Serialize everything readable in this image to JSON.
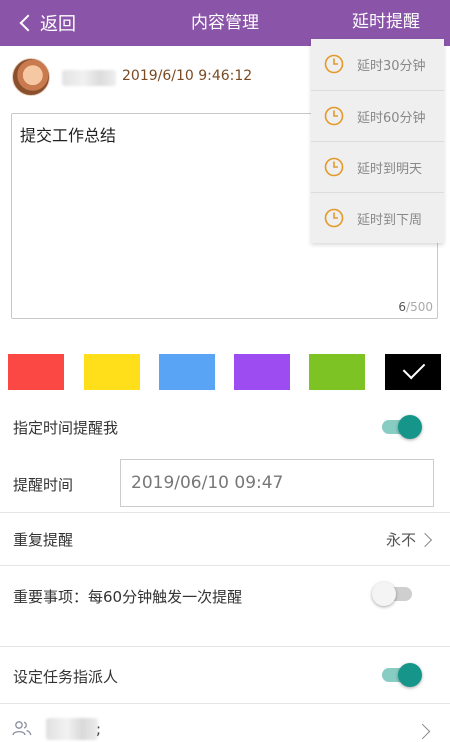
{
  "header": {
    "back_label": "返回",
    "title": "内容管理",
    "delay_label": "延时提醒"
  },
  "note": {
    "datetime": "2019/6/10 9:46:12",
    "content": "提交工作总结",
    "count_current": "6",
    "count_max": "/500"
  },
  "colors": {
    "header_bg": "#8a55a8",
    "toggle_on": "#16968a",
    "clock_orange": "#e39a2a",
    "swatches": [
      "#fb4844",
      "#ffdf19",
      "#5aa4f6",
      "#9c4cf1",
      "#7cc323",
      "#000000"
    ],
    "selected_swatch_index": 5
  },
  "settings": {
    "remind_me_label": "指定时间提醒我",
    "remind_me_on": true,
    "remind_time_label": "提醒时间",
    "remind_time_value": "2019/06/10 09:47",
    "repeat_label": "重复提醒",
    "repeat_value": "永不",
    "important_label": "重要事项：每60分钟触发一次提醒",
    "important_on": false,
    "assignee_label": "设定任务指派人",
    "assignee_on": true,
    "assignee_suffix": ";"
  },
  "delay_menu": {
    "items": [
      {
        "label": "延时30分钟",
        "icon": "clock-icon"
      },
      {
        "label": "延时60分钟",
        "icon": "clock-icon"
      },
      {
        "label": "延时到明天",
        "icon": "clock-icon"
      },
      {
        "label": "延时到下周",
        "icon": "clock-icon"
      }
    ]
  }
}
